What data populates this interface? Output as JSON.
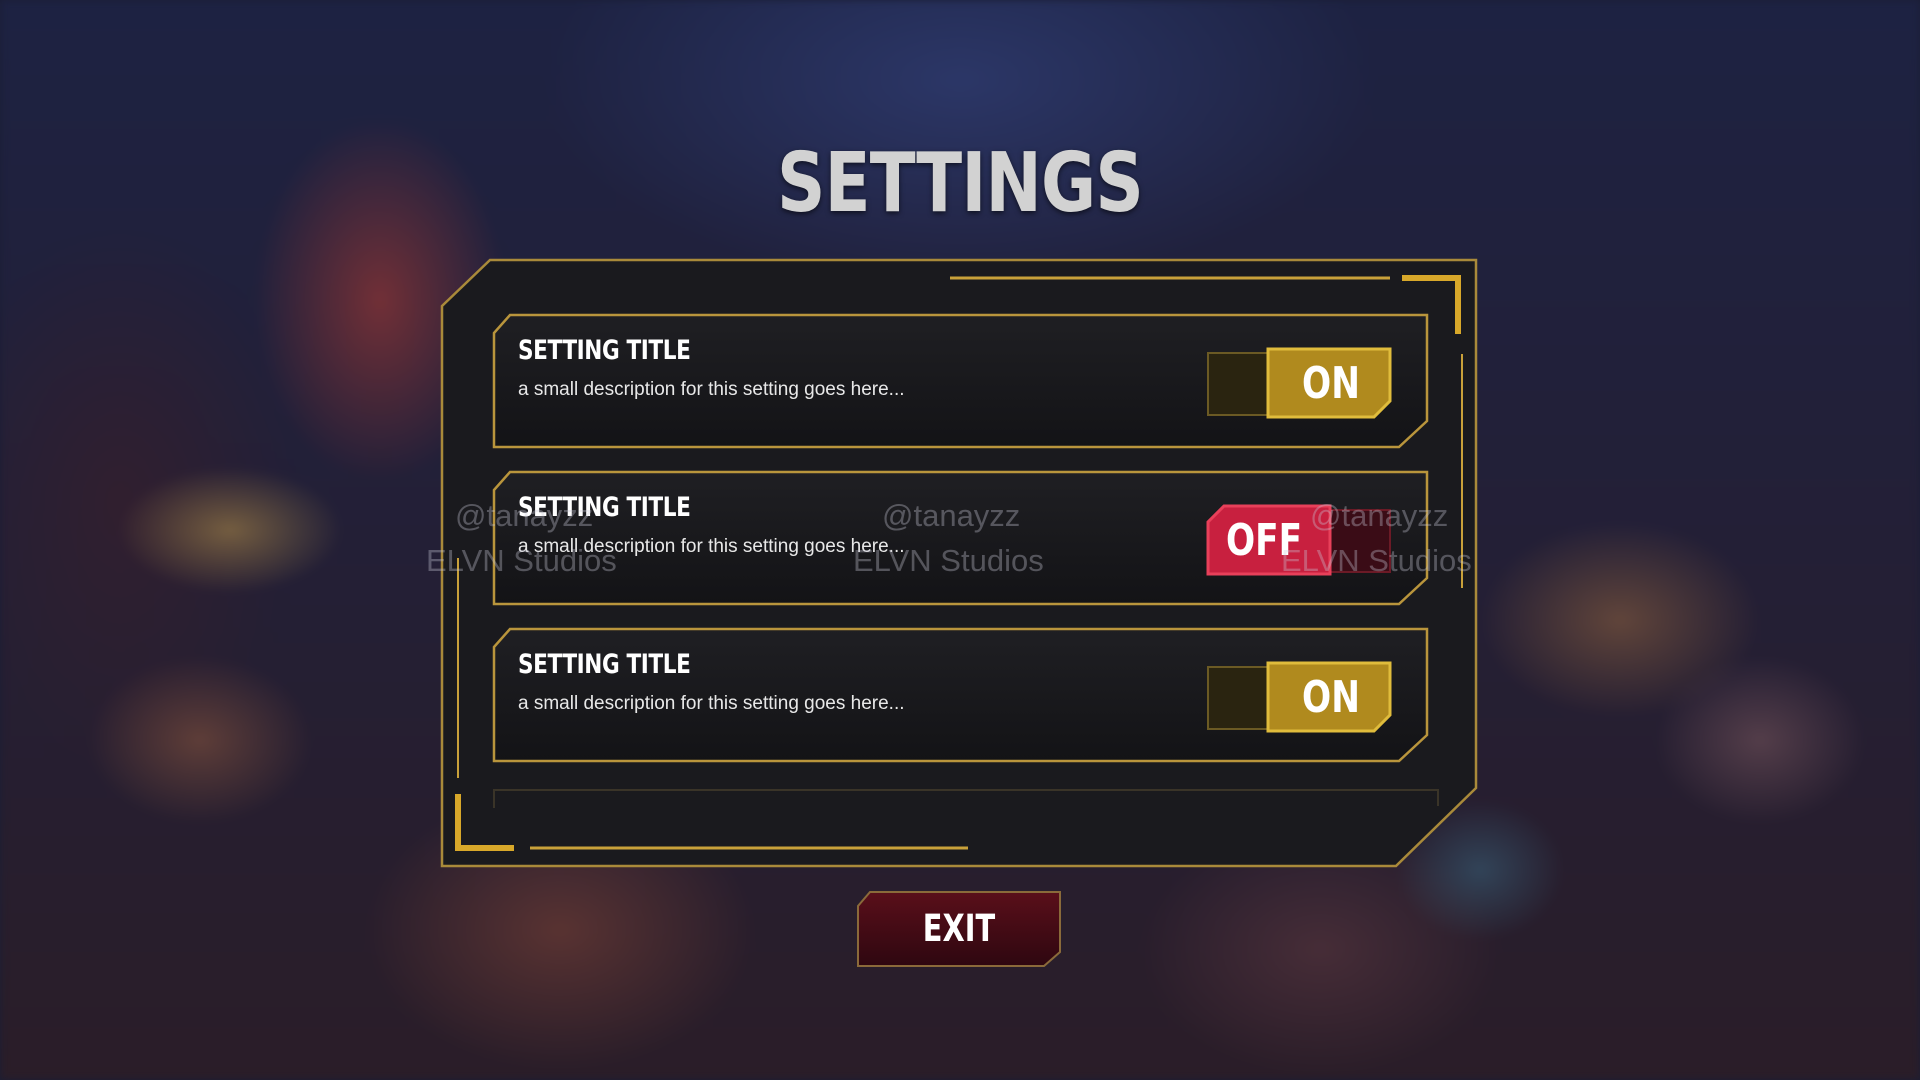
{
  "screen": {
    "title": "SETTINGS"
  },
  "settings": [
    {
      "title": "SETTING TITLE",
      "description": "a small description for this setting goes here...",
      "state": "ON"
    },
    {
      "title": "SETTING TITLE",
      "description": "a small description for this setting goes here...",
      "state": "OFF"
    },
    {
      "title": "SETTING TITLE",
      "description": "a small description for this setting goes here...",
      "state": "ON"
    }
  ],
  "exit": {
    "label": "EXIT"
  },
  "watermarks": [
    {
      "handle": "@tanayzz",
      "studio": "ELVN Studios"
    },
    {
      "handle": "@tanayzz",
      "studio": "ELVN Studios"
    },
    {
      "handle": "@tanayzz",
      "studio": "ELVN Studios"
    }
  ],
  "colors": {
    "accent_gold": "#c9a13a",
    "toggle_on": "#b08a1e",
    "toggle_off": "#c8203f",
    "exit_button": "#4a0c14"
  }
}
